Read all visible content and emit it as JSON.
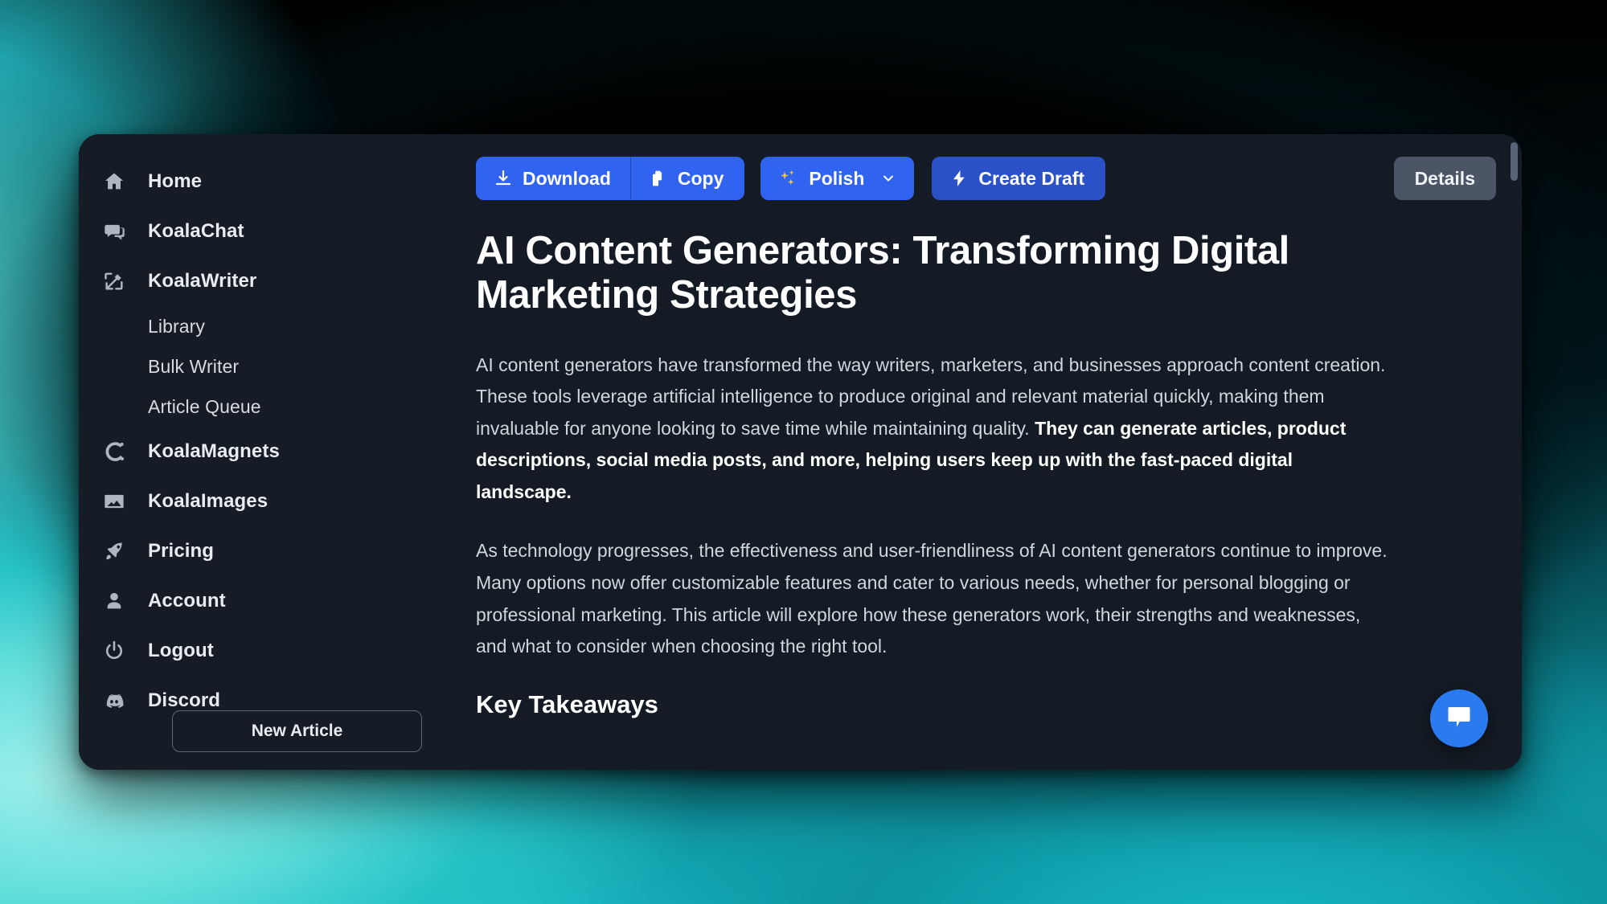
{
  "background": {
    "accent_teal": "#1bbcc6",
    "accent_cyan": "#63dfdc",
    "center": "#000000"
  },
  "window": {
    "surface_color": "#141b24",
    "sidebar_color": "#151c25"
  },
  "sidebar": {
    "items": [
      {
        "label": "Home",
        "icon": "home-icon",
        "sub": false
      },
      {
        "label": "KoalaChat",
        "icon": "chat-bubbles-icon",
        "sub": false
      },
      {
        "label": "KoalaWriter",
        "icon": "pencil-square-icon",
        "sub": false
      },
      {
        "label": "Library",
        "icon": "",
        "sub": true
      },
      {
        "label": "Bulk Writer",
        "icon": "",
        "sub": true
      },
      {
        "label": "Article Queue",
        "icon": "",
        "sub": true
      },
      {
        "label": "KoalaMagnets",
        "icon": "magnet-icon",
        "sub": false
      },
      {
        "label": "KoalaImages",
        "icon": "image-icon",
        "sub": false
      },
      {
        "label": "Pricing",
        "icon": "rocket-icon",
        "sub": false
      },
      {
        "label": "Account",
        "icon": "user-icon",
        "sub": false
      },
      {
        "label": "Logout",
        "icon": "power-icon",
        "sub": false
      },
      {
        "label": "Discord",
        "icon": "discord-icon",
        "sub": false
      }
    ],
    "new_article_label": "New Article"
  },
  "toolbar": {
    "download_label": "Download",
    "download_icon": "download-icon",
    "copy_label": "Copy",
    "copy_icon": "copy-icon",
    "polish_label": "Polish",
    "polish_icon": "sparkles-icon",
    "polish_chevron_icon": "chevron-down-icon",
    "create_draft_label": "Create Draft",
    "create_draft_icon": "lightning-bolt-icon",
    "details_label": "Details",
    "primary_color": "#2f63f0",
    "secondary_color": "#2a51c8",
    "details_color": "#4b5566",
    "sparkle_color": "#f5c542"
  },
  "article": {
    "title": "AI Content Generators: Transforming Digital Marketing Strategies",
    "paragraph1_part1": "AI content generators have transformed the way writers, marketers, and businesses approach content creation. These tools leverage artificial intelligence to produce original and relevant material quickly, making them invaluable for anyone looking to save time while maintaining quality. ",
    "paragraph1_bold": "They can generate articles, product descriptions, social media posts, and more, helping users keep up with the fast-paced digital landscape.",
    "paragraph2": "As technology progresses, the effectiveness and user-friendliness of AI content generators continue to improve. Many options now offer customizable features and cater to various needs, whether for personal blogging or professional marketing. This article will explore how these generators work, their strengths and weaknesses, and what to consider when choosing the right tool.",
    "section_heading": "Key Takeaways"
  },
  "chat_widget": {
    "icon": "chat-bubble-icon",
    "color": "#2a7af0"
  },
  "scrollbar": {
    "thumb_color": "#59637a"
  }
}
